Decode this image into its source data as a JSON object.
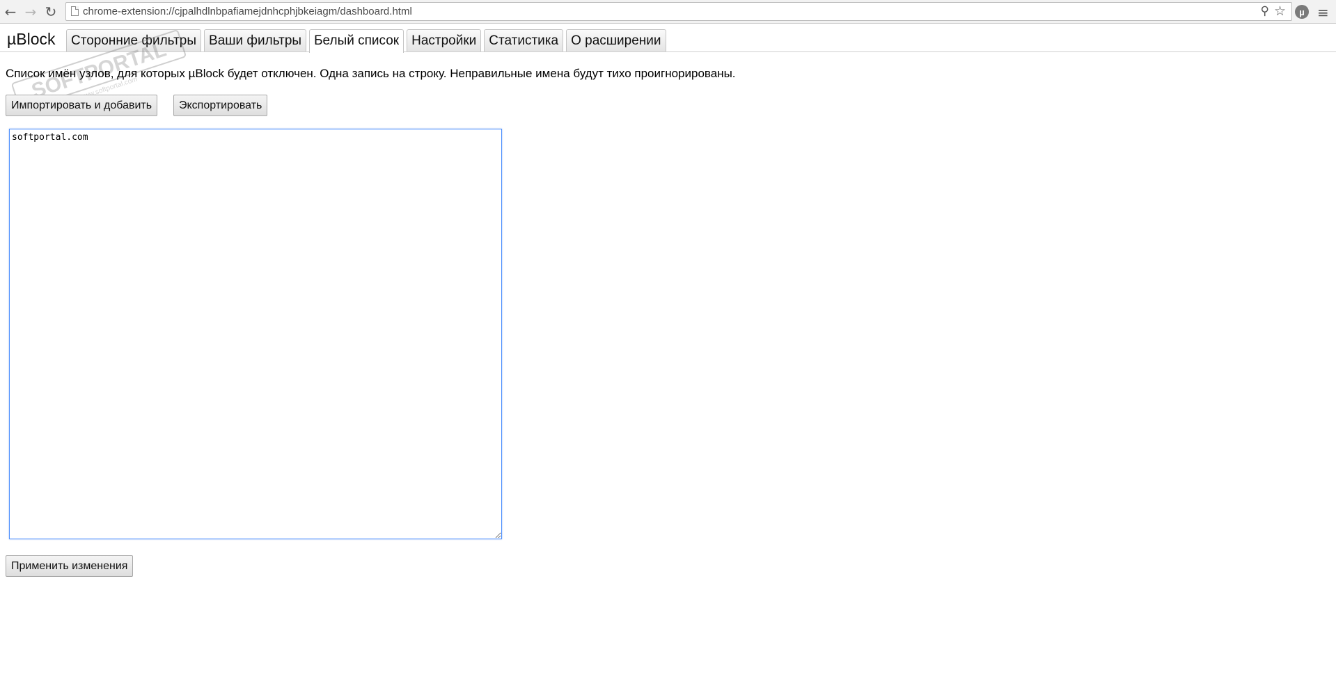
{
  "browser": {
    "url": "chrome-extension://cjpalhdlnbpafiamejdnhcphjbkeiagm/dashboard.html",
    "extension_icon": "µ",
    "icons": {
      "back": "back-arrow-icon",
      "forward": "forward-arrow-icon",
      "reload": "reload-icon",
      "page": "page-icon",
      "zoom": "zoom-icon",
      "bookmark": "star-icon",
      "menu": "hamburger-menu-icon"
    }
  },
  "app": {
    "logo": "µBlock",
    "tabs": [
      {
        "label": "Сторонние фильтры",
        "active": false
      },
      {
        "label": "Ваши фильтры",
        "active": false
      },
      {
        "label": "Белый список",
        "active": true
      },
      {
        "label": "Настройки",
        "active": false
      },
      {
        "label": "Статистика",
        "active": false
      },
      {
        "label": "О расширении",
        "active": false
      }
    ]
  },
  "whitelist": {
    "description": "Список имён узлов, для которых µBlock будет отключен. Одна запись на строку. Неправильные имена будут тихо проигнорированы.",
    "import_label": "Импортировать и добавить",
    "export_label": "Экспортировать",
    "content": "softportal.com",
    "apply_label": "Применить изменения"
  },
  "watermark": {
    "text": "SOFTPORTAL",
    "subtext": "www.softportal.com"
  },
  "colors": {
    "focus_border": "#4d90fe",
    "toolbar_bg": "#f2f2f2"
  }
}
